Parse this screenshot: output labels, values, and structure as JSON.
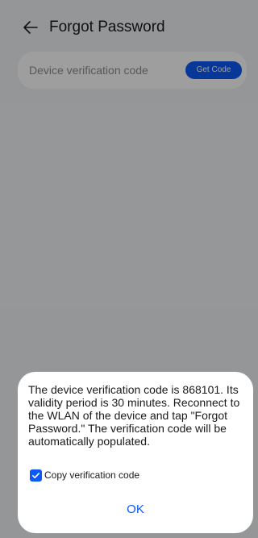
{
  "header": {
    "back_icon": "arrow-left-icon",
    "title": "Forgot Password"
  },
  "form": {
    "verification_field": {
      "placeholder": "Device verification code",
      "button_label": "Get Code"
    }
  },
  "dialog": {
    "message": "The device verification code is 868101. Its validity period is 30 minutes. Reconnect to the WLAN of the device and tap \"Forgot Password.\" The verification code will be automatically populated.",
    "copy_checkbox": {
      "label": "Copy verification code",
      "checked": true,
      "icon": "checkmark-icon"
    },
    "ok_label": "OK"
  },
  "colors": {
    "accent": "#0a59f7",
    "background": "#f1f3f5",
    "scrim": "rgba(0,0,0,0.38)"
  }
}
